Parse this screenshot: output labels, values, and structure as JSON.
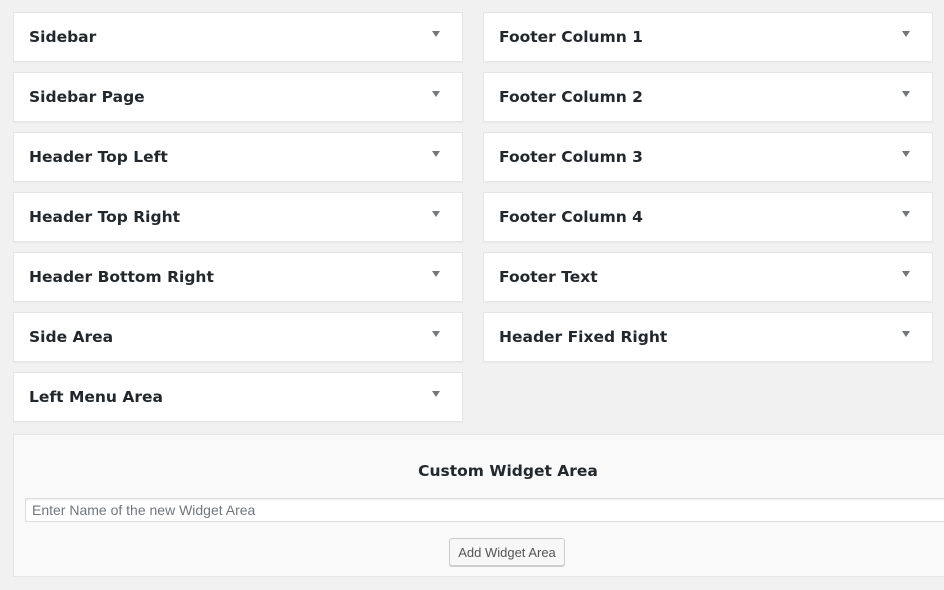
{
  "widget_areas": {
    "left": [
      {
        "title": "Sidebar"
      },
      {
        "title": "Sidebar Page"
      },
      {
        "title": "Header Top Left"
      },
      {
        "title": "Header Top Right"
      },
      {
        "title": "Header Bottom Right"
      },
      {
        "title": "Side Area"
      },
      {
        "title": "Left Menu Area"
      }
    ],
    "right": [
      {
        "title": "Footer Column 1"
      },
      {
        "title": "Footer Column 2"
      },
      {
        "title": "Footer Column 3"
      },
      {
        "title": "Footer Column 4"
      },
      {
        "title": "Footer Text"
      },
      {
        "title": "Header Fixed Right"
      }
    ]
  },
  "custom_widget_area": {
    "title": "Custom Widget Area",
    "input_placeholder": "Enter Name of the new Widget Area",
    "input_value": "",
    "button_label": "Add Widget Area"
  },
  "icons": {
    "toggle": "arrow-down-icon"
  },
  "colors": {
    "background": "#f1f1f1",
    "panel": "#ffffff",
    "border": "#e5e5e5",
    "text": "#23282d"
  }
}
